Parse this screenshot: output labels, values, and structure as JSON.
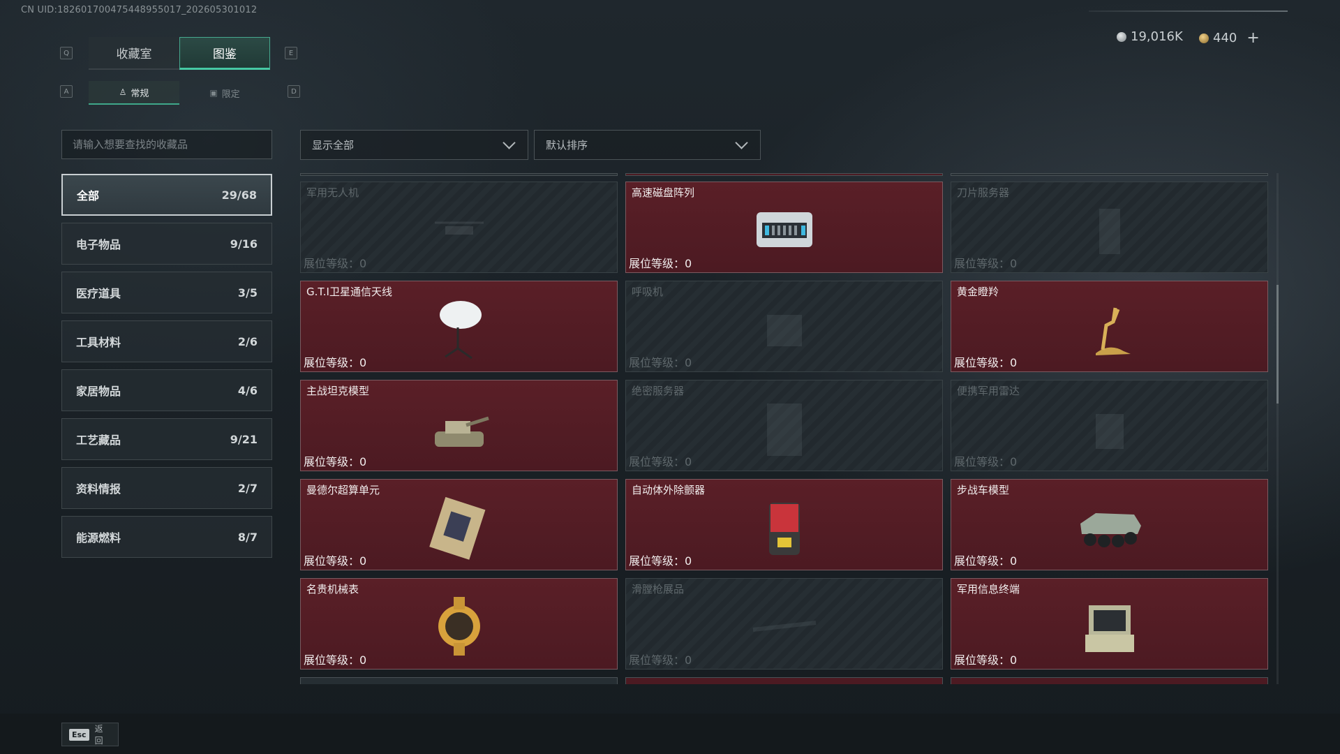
{
  "uid_text": "CN UID:182601700475448955017_202605301012",
  "currency": {
    "silver": "19,016K",
    "gold": "440",
    "add": "+"
  },
  "keys": {
    "prev_tab": "Q",
    "next_tab": "E",
    "prev_sub": "A",
    "next_sub": "D"
  },
  "tabs": [
    {
      "label": "收藏室",
      "active": false
    },
    {
      "label": "图鉴",
      "active": true
    }
  ],
  "subtabs": [
    {
      "label": "常规",
      "active": true
    },
    {
      "label": "限定",
      "active": false
    }
  ],
  "search": {
    "placeholder": "请输入想要查找的收藏品"
  },
  "filters": {
    "show": "显示全部",
    "sort": "默认排序"
  },
  "categories": [
    {
      "label": "全部",
      "count": "29/68",
      "active": true
    },
    {
      "label": "电子物品",
      "count": "9/16"
    },
    {
      "label": "医疗道具",
      "count": "3/5"
    },
    {
      "label": "工具材料",
      "count": "2/6"
    },
    {
      "label": "家居物品",
      "count": "4/6"
    },
    {
      "label": "工艺藏品",
      "count": "9/21"
    },
    {
      "label": "资料情报",
      "count": "2/7"
    },
    {
      "label": "能源燃料",
      "count": "8/7"
    }
  ],
  "items": [
    {
      "name": "军用无人机",
      "level": "展位等级：0",
      "owned": false,
      "icon": "drone-icon"
    },
    {
      "name": "高速磁盘阵列",
      "level": "展位等级：0",
      "owned": true,
      "icon": "disk-array-icon"
    },
    {
      "name": "刀片服务器",
      "level": "展位等级：0",
      "owned": false,
      "icon": "blade-server-icon"
    },
    {
      "name": "G.T.I卫星通信天线",
      "level": "展位等级：0",
      "owned": true,
      "icon": "satellite-dish-icon"
    },
    {
      "name": "呼吸机",
      "level": "展位等级：0",
      "owned": false,
      "icon": "ventilator-icon"
    },
    {
      "name": "黄金瞪羚",
      "level": "展位等级：0",
      "owned": true,
      "icon": "golden-gazelle-icon"
    },
    {
      "name": "主战坦克模型",
      "level": "展位等级：0",
      "owned": true,
      "icon": "tank-model-icon"
    },
    {
      "name": "绝密服务器",
      "level": "展位等级：0",
      "owned": false,
      "icon": "secret-server-icon"
    },
    {
      "name": "便携军用雷达",
      "level": "展位等级：0",
      "owned": false,
      "icon": "radar-icon"
    },
    {
      "name": "曼德尔超算单元",
      "level": "展位等级：0",
      "owned": true,
      "icon": "cpu-unit-icon"
    },
    {
      "name": "自动体外除颤器",
      "level": "展位等级：0",
      "owned": true,
      "icon": "defibrillator-icon"
    },
    {
      "name": "步战车模型",
      "level": "展位等级：0",
      "owned": true,
      "icon": "ifv-model-icon"
    },
    {
      "name": "名贵机械表",
      "level": "展位等级：0",
      "owned": true,
      "icon": "watch-icon"
    },
    {
      "name": "滑膛枪展品",
      "level": "展位等级：0",
      "owned": false,
      "icon": "musket-icon"
    },
    {
      "name": "军用信息终端",
      "level": "展位等级：0",
      "owned": true,
      "icon": "terminal-icon"
    }
  ],
  "partial_row": [
    {
      "name": "",
      "owned": false
    },
    {
      "name": "",
      "owned": true
    },
    {
      "name": "",
      "owned": true
    }
  ],
  "footer": {
    "esc_key": "Esc",
    "back_label": "返回"
  },
  "colors": {
    "owned_card": "#4c1a22",
    "locked_card": "#262e33",
    "accent": "#46c9a3"
  }
}
